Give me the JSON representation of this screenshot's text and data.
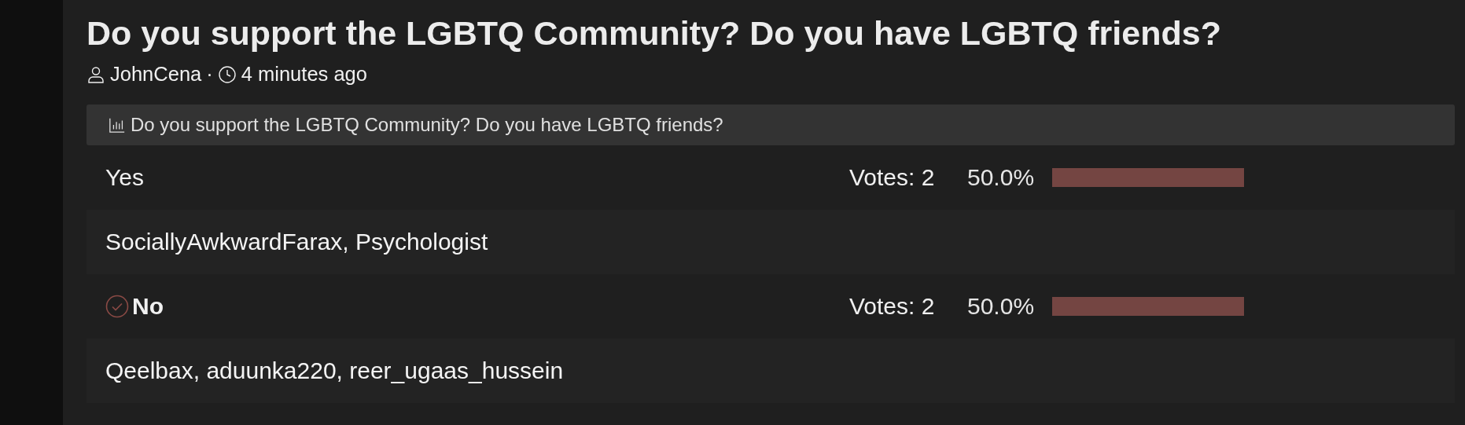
{
  "thread": {
    "title": "Do you support the LGBTQ Community? Do you have LGBTQ friends?",
    "author": "JohnCena",
    "separator": "·",
    "time": "4 minutes ago"
  },
  "poll": {
    "question": "Do you support the LGBTQ Community? Do you have LGBTQ friends?",
    "options": [
      {
        "label": "Yes",
        "selected": false,
        "votes": "Votes: 2",
        "percent": "50.0%",
        "voters": "SociallyAwkwardFarax, Psychologist"
      },
      {
        "label": "No",
        "selected": true,
        "votes": "Votes: 2",
        "percent": "50.0%",
        "voters": "Qeelbax, aduunka220, reer_ugaas_hussein"
      }
    ]
  }
}
